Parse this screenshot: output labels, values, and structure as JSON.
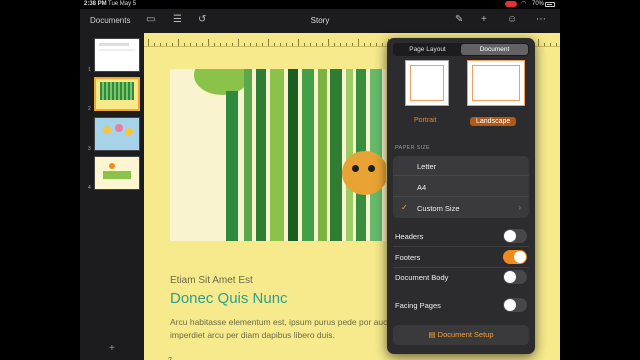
{
  "status_bar": {
    "time": "2:38 PM",
    "date": "Tue May 5",
    "battery": "70%"
  },
  "toolbar": {
    "documents_label": "Documents",
    "title": "Story",
    "icons": [
      "sidebar-icon",
      "list-icon",
      "undo-icon",
      "brush-icon",
      "plus-icon",
      "collaborate-icon",
      "more-icon"
    ]
  },
  "sidebar": {
    "pages": [
      {
        "number": "1",
        "selected": false
      },
      {
        "number": "2",
        "selected": true
      },
      {
        "number": "3",
        "selected": false
      },
      {
        "number": "4",
        "selected": false
      }
    ],
    "add_label": "+"
  },
  "page": {
    "subtitle": "Etiam Sit Amet Est",
    "title": "Donec Quis Nunc",
    "body": "Arcu habitasse elementum est, ipsum purus pede por auctor, imperdiet arcu per diam dapibus libero duis.",
    "page_number": "2"
  },
  "popover": {
    "tabs": [
      {
        "label": "Page Layout",
        "active": false
      },
      {
        "label": "Document",
        "active": true
      }
    ],
    "orientation": {
      "portrait_label": "Portrait",
      "landscape_label": "Landscape",
      "selected": "Landscape"
    },
    "paper_size_header": "PAPER SIZE",
    "paper_sizes": [
      {
        "label": "Letter",
        "checked": false
      },
      {
        "label": "A4",
        "checked": false
      },
      {
        "label": "Custom Size",
        "checked": true
      }
    ],
    "toggles": [
      {
        "label": "Headers",
        "on": false
      },
      {
        "label": "Footers",
        "on": true
      },
      {
        "label": "Document Body",
        "on": false
      },
      {
        "label": "Facing Pages",
        "on": false
      }
    ],
    "setup_button": "Document Setup"
  },
  "colors": {
    "accent": "#f08a1c",
    "page_background": "#f6ea8c",
    "title_teal": "#2aa08e",
    "popover_bg": "#2c2c2e"
  }
}
